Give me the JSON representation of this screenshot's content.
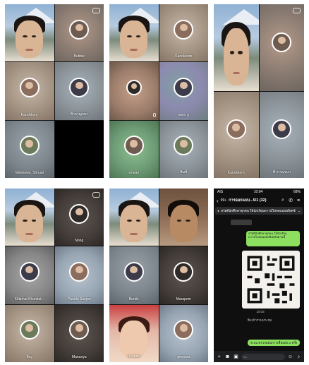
{
  "calls": [
    {
      "tiles": [
        {
          "name": ""
        },
        {
          "name": "Bubble"
        },
        {
          "name": "Kanokkorn"
        },
        {
          "name": "ฟ้ากาญจนา"
        },
        {
          "name": "Maneewa_Srinual"
        },
        {
          "name": ""
        }
      ]
    },
    {
      "tiles": [
        {
          "name": ""
        },
        {
          "name": "Kanokkorn"
        },
        {
          "name": ""
        },
        {
          "name": "aomi g"
        },
        {
          "name": "smean"
        },
        {
          "name": "พิมพ์"
        }
      ]
    },
    {
      "tiles": [
        {
          "name": ""
        },
        {
          "name": ""
        },
        {
          "name": "Kanokkorn"
        },
        {
          "name": "ฟ้ากาญจนา"
        }
      ]
    },
    {
      "tiles": [
        {
          "name": ""
        },
        {
          "name": "Nong"
        },
        {
          "name": "Kittiphat Khuntiat..."
        },
        {
          "name": "Panida Suejan"
        },
        {
          "name": "Boy"
        },
        {
          "name": "Manunya"
        }
      ]
    },
    {
      "tiles": [
        {
          "name": ""
        },
        {
          "name": ""
        },
        {
          "name": "Bentik"
        },
        {
          "name": "Marapom"
        },
        {
          "name": "ปลายฝน"
        },
        {
          "name": "pimnipa"
        }
      ]
    }
  ],
  "chat": {
    "status": {
      "carrier": "AIS",
      "time": "10:04",
      "battery": "68%"
    },
    "header": {
      "back": "‹",
      "badge": "99+",
      "title": "การออกแบบ...5/1 (32)"
    },
    "announcement": "สวัสดีนักศึกษาทุกคน ให้นักเรียนดาวน์โหลดแอปพลิเคชัน...",
    "message_out": "สวัสดีนักศึกษาทุกคน ให้นักเรียนดาวน์โหลดแอปพลิเคชันตามนี้",
    "time_label": "10:03",
    "system_message": "ซิมเข้าร่วมประชุม",
    "message_out2": "ระบบ ตรวจสอบการเชื่อมต่อ 2 ครั้ง",
    "input_placeholder": "Aa"
  }
}
